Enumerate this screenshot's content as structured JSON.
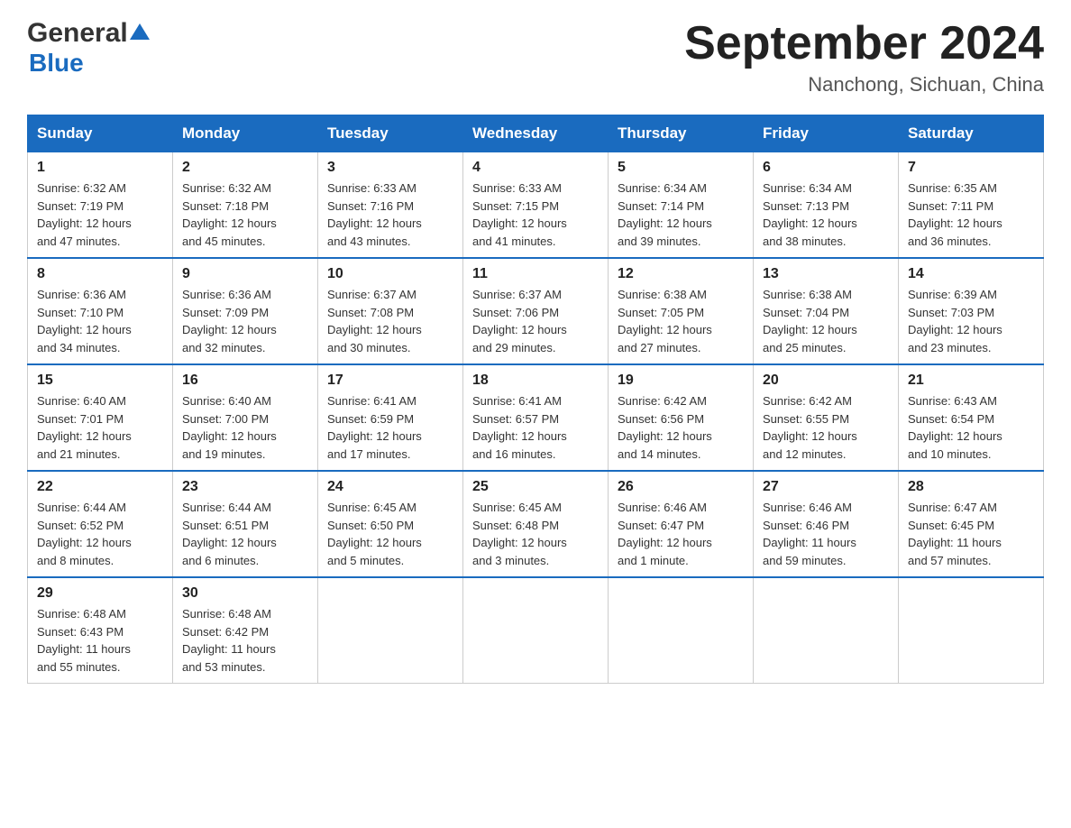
{
  "header": {
    "logo_general": "General",
    "logo_blue": "Blue",
    "month_title": "September 2024",
    "location": "Nanchong, Sichuan, China"
  },
  "days_of_week": [
    "Sunday",
    "Monday",
    "Tuesday",
    "Wednesday",
    "Thursday",
    "Friday",
    "Saturday"
  ],
  "weeks": [
    [
      {
        "day": "1",
        "sunrise": "6:32 AM",
        "sunset": "7:19 PM",
        "daylight": "12 hours and 47 minutes."
      },
      {
        "day": "2",
        "sunrise": "6:32 AM",
        "sunset": "7:18 PM",
        "daylight": "12 hours and 45 minutes."
      },
      {
        "day": "3",
        "sunrise": "6:33 AM",
        "sunset": "7:16 PM",
        "daylight": "12 hours and 43 minutes."
      },
      {
        "day": "4",
        "sunrise": "6:33 AM",
        "sunset": "7:15 PM",
        "daylight": "12 hours and 41 minutes."
      },
      {
        "day": "5",
        "sunrise": "6:34 AM",
        "sunset": "7:14 PM",
        "daylight": "12 hours and 39 minutes."
      },
      {
        "day": "6",
        "sunrise": "6:34 AM",
        "sunset": "7:13 PM",
        "daylight": "12 hours and 38 minutes."
      },
      {
        "day": "7",
        "sunrise": "6:35 AM",
        "sunset": "7:11 PM",
        "daylight": "12 hours and 36 minutes."
      }
    ],
    [
      {
        "day": "8",
        "sunrise": "6:36 AM",
        "sunset": "7:10 PM",
        "daylight": "12 hours and 34 minutes."
      },
      {
        "day": "9",
        "sunrise": "6:36 AM",
        "sunset": "7:09 PM",
        "daylight": "12 hours and 32 minutes."
      },
      {
        "day": "10",
        "sunrise": "6:37 AM",
        "sunset": "7:08 PM",
        "daylight": "12 hours and 30 minutes."
      },
      {
        "day": "11",
        "sunrise": "6:37 AM",
        "sunset": "7:06 PM",
        "daylight": "12 hours and 29 minutes."
      },
      {
        "day": "12",
        "sunrise": "6:38 AM",
        "sunset": "7:05 PM",
        "daylight": "12 hours and 27 minutes."
      },
      {
        "day": "13",
        "sunrise": "6:38 AM",
        "sunset": "7:04 PM",
        "daylight": "12 hours and 25 minutes."
      },
      {
        "day": "14",
        "sunrise": "6:39 AM",
        "sunset": "7:03 PM",
        "daylight": "12 hours and 23 minutes."
      }
    ],
    [
      {
        "day": "15",
        "sunrise": "6:40 AM",
        "sunset": "7:01 PM",
        "daylight": "12 hours and 21 minutes."
      },
      {
        "day": "16",
        "sunrise": "6:40 AM",
        "sunset": "7:00 PM",
        "daylight": "12 hours and 19 minutes."
      },
      {
        "day": "17",
        "sunrise": "6:41 AM",
        "sunset": "6:59 PM",
        "daylight": "12 hours and 17 minutes."
      },
      {
        "day": "18",
        "sunrise": "6:41 AM",
        "sunset": "6:57 PM",
        "daylight": "12 hours and 16 minutes."
      },
      {
        "day": "19",
        "sunrise": "6:42 AM",
        "sunset": "6:56 PM",
        "daylight": "12 hours and 14 minutes."
      },
      {
        "day": "20",
        "sunrise": "6:42 AM",
        "sunset": "6:55 PM",
        "daylight": "12 hours and 12 minutes."
      },
      {
        "day": "21",
        "sunrise": "6:43 AM",
        "sunset": "6:54 PM",
        "daylight": "12 hours and 10 minutes."
      }
    ],
    [
      {
        "day": "22",
        "sunrise": "6:44 AM",
        "sunset": "6:52 PM",
        "daylight": "12 hours and 8 minutes."
      },
      {
        "day": "23",
        "sunrise": "6:44 AM",
        "sunset": "6:51 PM",
        "daylight": "12 hours and 6 minutes."
      },
      {
        "day": "24",
        "sunrise": "6:45 AM",
        "sunset": "6:50 PM",
        "daylight": "12 hours and 5 minutes."
      },
      {
        "day": "25",
        "sunrise": "6:45 AM",
        "sunset": "6:48 PM",
        "daylight": "12 hours and 3 minutes."
      },
      {
        "day": "26",
        "sunrise": "6:46 AM",
        "sunset": "6:47 PM",
        "daylight": "12 hours and 1 minute."
      },
      {
        "day": "27",
        "sunrise": "6:46 AM",
        "sunset": "6:46 PM",
        "daylight": "11 hours and 59 minutes."
      },
      {
        "day": "28",
        "sunrise": "6:47 AM",
        "sunset": "6:45 PM",
        "daylight": "11 hours and 57 minutes."
      }
    ],
    [
      {
        "day": "29",
        "sunrise": "6:48 AM",
        "sunset": "6:43 PM",
        "daylight": "11 hours and 55 minutes."
      },
      {
        "day": "30",
        "sunrise": "6:48 AM",
        "sunset": "6:42 PM",
        "daylight": "11 hours and 53 minutes."
      },
      null,
      null,
      null,
      null,
      null
    ]
  ],
  "labels": {
    "sunrise_prefix": "Sunrise: ",
    "sunset_prefix": "Sunset: ",
    "daylight_prefix": "Daylight: "
  }
}
